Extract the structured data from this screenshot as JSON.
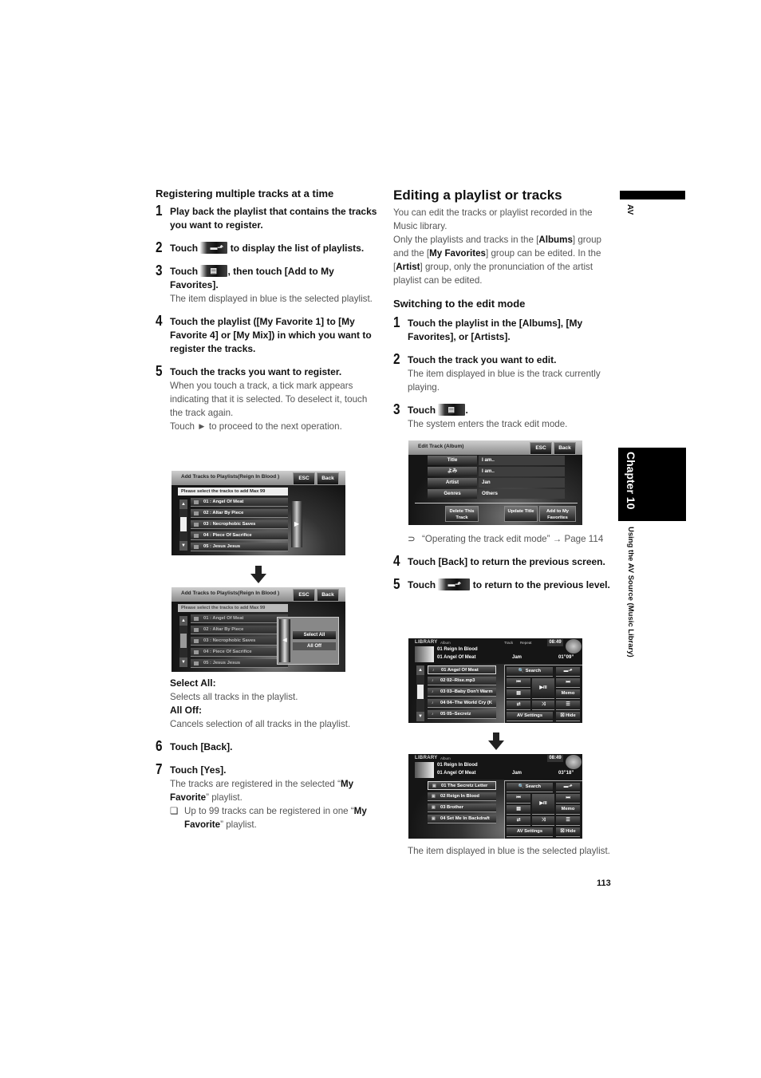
{
  "left_column": {
    "heading": "Registering multiple tracks at a time",
    "steps": [
      {
        "num": "1",
        "title": "Play back the playlist that contains the tracks you want to register."
      },
      {
        "num": "2",
        "title_before": "Touch",
        "title_after": "to display the list of playlists.",
        "icon": "playlist-up-icon"
      },
      {
        "num": "3",
        "title_before": "Touch",
        "title_after": ", then touch [Add to My Favorites].",
        "icon": "edit-icon",
        "desc": "The item displayed in blue is the selected playlist."
      },
      {
        "num": "4",
        "title": "Touch the playlist ([My Favorite 1] to [My Favorite 4] or [My Mix]) in which you want to register the tracks."
      },
      {
        "num": "5",
        "title": "Touch the tracks you want to register.",
        "desc": "When you touch a track, a tick mark appears indicating that it is selected. To deselect it, touch the track again.",
        "desc2": "Touch ► to proceed to the next operation."
      },
      {
        "num": "6",
        "title": "Touch [Back]."
      },
      {
        "num": "7",
        "title": "Touch [Yes].",
        "desc_before": "The tracks are registered in the selected “",
        "desc_bold": "My Favorite",
        "desc_after": "” playlist."
      }
    ],
    "select_all_label": "Select All:",
    "select_all_desc": "Selects all tracks in the playlist.",
    "all_off_label": "All Off:",
    "all_off_desc": "Cancels selection of all tracks in the playlist.",
    "note_mark": "❏",
    "note_before": "Up to 99 tracks can be registered in one “",
    "note_bold": "My Favorite",
    "note_after": "” playlist."
  },
  "screen_add_tracks": {
    "title": "Add Tracks to Playlists(Reign In Blood )",
    "esc": "ESC",
    "back": "Back",
    "prompt": "Please select the tracks to add   Max 99",
    "tracks": [
      "01 : Angel Of Meat",
      "02 : Altar By Piece",
      "03 : Necrophobic Saves",
      "04 : Piece Of Sacrifice",
      "05 : Jesus Jesus"
    ],
    "next_arrow": "▶",
    "popup_arrow": "◀",
    "popup_select_all": "Select All",
    "popup_all_off": "All Off"
  },
  "right_column": {
    "heading": "Editing a playlist or tracks",
    "intro": "You can edit the tracks or playlist recorded in the Music library.",
    "p2_a": "Only the playlists and tracks in the [",
    "p2_b": "Albums",
    "p2_c": "] group and the [",
    "p2_d": "My Favorites",
    "p2_e": "] group can be edited. In the [",
    "p2_f": "Artist",
    "p2_g": "] group, only the pronunciation of the artist playlist can be edited.",
    "subheading": "Switching to the edit mode",
    "steps": [
      {
        "num": "1",
        "title": "Touch the playlist in the [Albums], [My Favorites], or [Artists]."
      },
      {
        "num": "2",
        "title": "Touch the track you want to edit.",
        "desc": "The item displayed in blue is the track currently playing."
      },
      {
        "num": "3",
        "title_before": "Touch",
        "title_after": ".",
        "desc": "The system enters the track edit mode."
      },
      {
        "num": "4",
        "title": "Touch [Back] to return the previous screen."
      },
      {
        "num": "5",
        "title_before": "Touch",
        "title_after": "to return to the previous level."
      }
    ],
    "crossref_mark": "⊃",
    "crossref": "“Operating the track edit mode” → Page 114",
    "final_desc": "The item displayed in blue is the selected playlist."
  },
  "screen_edit_track": {
    "title": "Edit Track (Album)",
    "esc": "ESC",
    "back": "Back",
    "rows": [
      {
        "label": "Title",
        "value": "I am.."
      },
      {
        "label": "よみ",
        "value": "I am.."
      },
      {
        "label": "Artist",
        "value": "Jan"
      },
      {
        "label": "Genres",
        "value": "Others"
      }
    ],
    "btn_delete": "Delete This Track",
    "btn_update": "Update Title",
    "btn_add": "Add to My Favorites"
  },
  "screen_library_1": {
    "label": "LIBRARY",
    "group": "Album",
    "track": "Track",
    "repeat": "Repeat",
    "clock": "08:49",
    "line1": "01 Reign In Blood",
    "line2": "01 Angel Of Meat",
    "artist": "Jam",
    "time": "01”09”",
    "rows": [
      "01 Angel Of Meat",
      "02 02–Rise.mp3",
      "03 03–Baby Don't Warm",
      "04 04–The World Cry (K",
      "05 05–Secretz"
    ],
    "controls": {
      "search": "Search",
      "prev": "⏮",
      "play": "▶/II",
      "next": "⏭",
      "memo": "Memo",
      "av_settings": "AV Settings",
      "hide": "Hide"
    }
  },
  "screen_library_2": {
    "label": "LIBRARY",
    "group": "Album",
    "clock": "08:49",
    "line1": "01 Reign In Blood",
    "line2": "01 Angel Of Meat",
    "artist": "Jam",
    "time": "03”18”",
    "rows": [
      "01 The Secretz Letter",
      "02 Reign In Blood",
      "03 Brother",
      "04 Set Me In Backdraft"
    ],
    "controls": {
      "search": "Search",
      "prev": "⏮",
      "play": "▶/II",
      "next": "⏭",
      "memo": "Memo",
      "av_settings": "AV Settings",
      "hide": "Hide"
    }
  },
  "sidebar": {
    "av": "AV",
    "chapter": "Chapter 10",
    "subtitle": "Using the AV Source (Music Library)"
  },
  "page_number": "113"
}
